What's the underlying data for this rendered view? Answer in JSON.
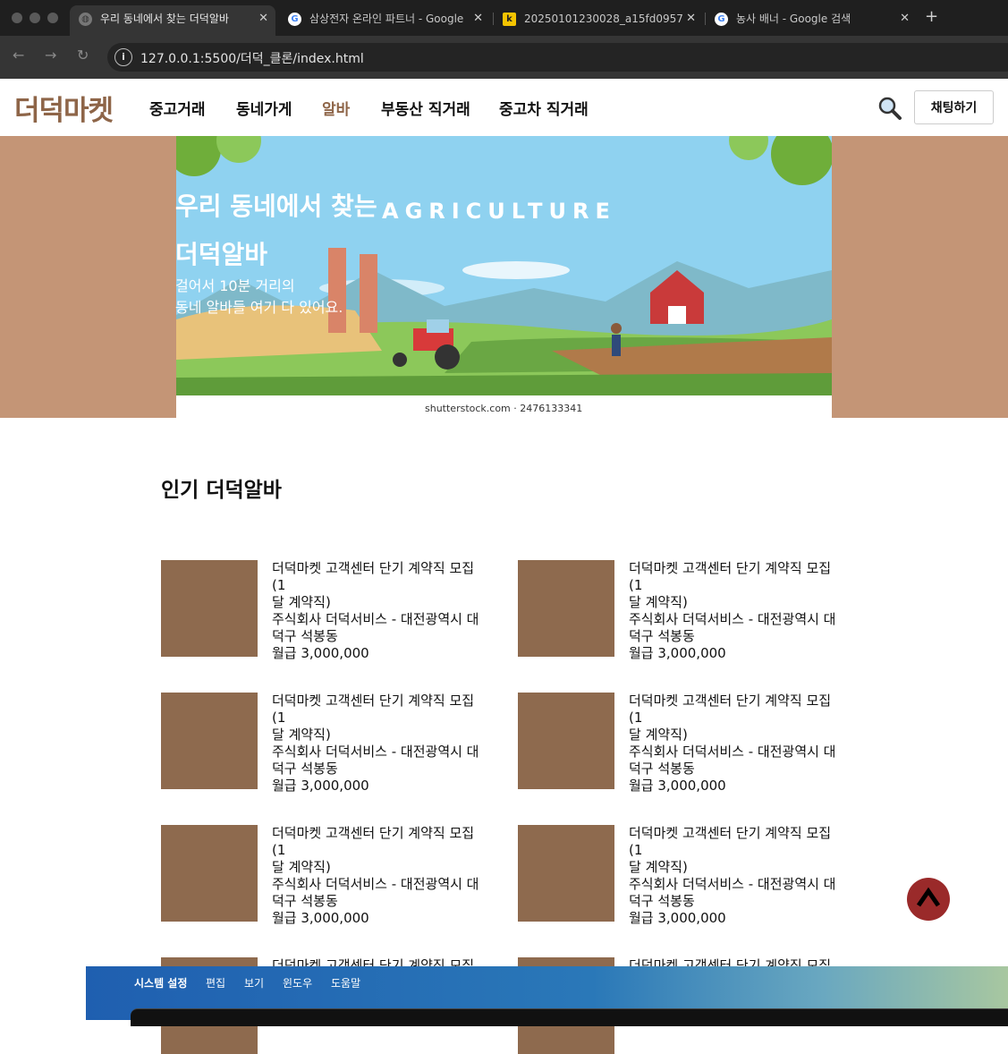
{
  "browser": {
    "tabs": [
      {
        "title": "우리 동네에서 찾는 더덕알바",
        "active": true,
        "icon": "globe-icon"
      },
      {
        "title": "삼상전자 온라인 파트너 - Google",
        "active": false,
        "icon": "google-icon"
      },
      {
        "title": "20250101230028_a15fd0957",
        "active": false,
        "icon": "k-icon"
      },
      {
        "title": "농사 배너 - Google 검색",
        "active": false,
        "icon": "google-icon"
      }
    ],
    "new_tab": "+",
    "url": "127.0.0.1:5500/더덕_클론/index.html"
  },
  "header": {
    "logo": "더덕마켓",
    "nav": [
      "중고거래",
      "동네가게",
      "알바",
      "부동산 직거래",
      "중고차 직거래"
    ],
    "active_nav": "알바",
    "chat_button": "채팅하기"
  },
  "hero": {
    "title_line1": "우리 동네에서 찾는",
    "title_line2": "더덕알바",
    "sub_line1": "걸어서 10분 거리의",
    "sub_line2": "동네 알바들 여기 다 있어요.",
    "image_text": "AGRICULTURE",
    "image_credit": "shutterstock.com · 2476133341",
    "bg_color": "#c49576"
  },
  "section": {
    "title": "인기 더덕알바",
    "cards": [
      {
        "line1": "더덕마켓 고객센터 단기 계약직 모집(1",
        "line2": "달 계약직)",
        "line3": "주식회사 더덕서비스 - 대전광역시 대",
        "line4": "덕구 석봉동",
        "line5": "월급 3,000,000"
      },
      {
        "line1": "더덕마켓 고객센터 단기 계약직 모집(1",
        "line2": "달 계약직)",
        "line3": "주식회사 더덕서비스 - 대전광역시 대",
        "line4": "덕구 석봉동",
        "line5": "월급 3,000,000"
      },
      {
        "line1": "더덕마켓 고객센터 단기 계약직 모집(1",
        "line2": "달 계약직)",
        "line3": "주식회사 더덕서비스 - 대전광역시 대",
        "line4": "덕구 석봉동",
        "line5": "월급 3,000,000"
      },
      {
        "line1": "더덕마켓 고객센터 단기 계약직 모집(1",
        "line2": "달 계약직)",
        "line3": "주식회사 더덕서비스 - 대전광역시 대",
        "line4": "덕구 석봉동",
        "line5": "월급 3,000,000"
      },
      {
        "line1": "더덕마켓 고객센터 단기 계약직 모집(1",
        "line2": "달 계약직)",
        "line3": "주식회사 더덕서비스 - 대전광역시 대",
        "line4": "덕구 석봉동",
        "line5": "월급 3,000,000"
      },
      {
        "line1": "더덕마켓 고객센터 단기 계약직 모집(1",
        "line2": "달 계약직)",
        "line3": "주식회사 더덕서비스 - 대전광역시 대",
        "line4": "덕구 석봉동",
        "line5": "월급 3,000,000"
      },
      {
        "line1": "더덕마켓 고객센터 단기 계약직 모집(1",
        "line2": "",
        "line3": "",
        "line4": "",
        "line5": ""
      },
      {
        "line1": "더덕마켓 고객센터 단기 계약직 모집(1",
        "line2": "",
        "line3": "",
        "line4": "",
        "line5": ""
      }
    ]
  },
  "macos": {
    "menu": [
      "시스템 설정",
      "편집",
      "보기",
      "윈도우",
      "도움말"
    ]
  },
  "colors": {
    "brand": "#8e6548",
    "thumb": "#8e6a4e",
    "top_button": "#9a2a2a"
  }
}
